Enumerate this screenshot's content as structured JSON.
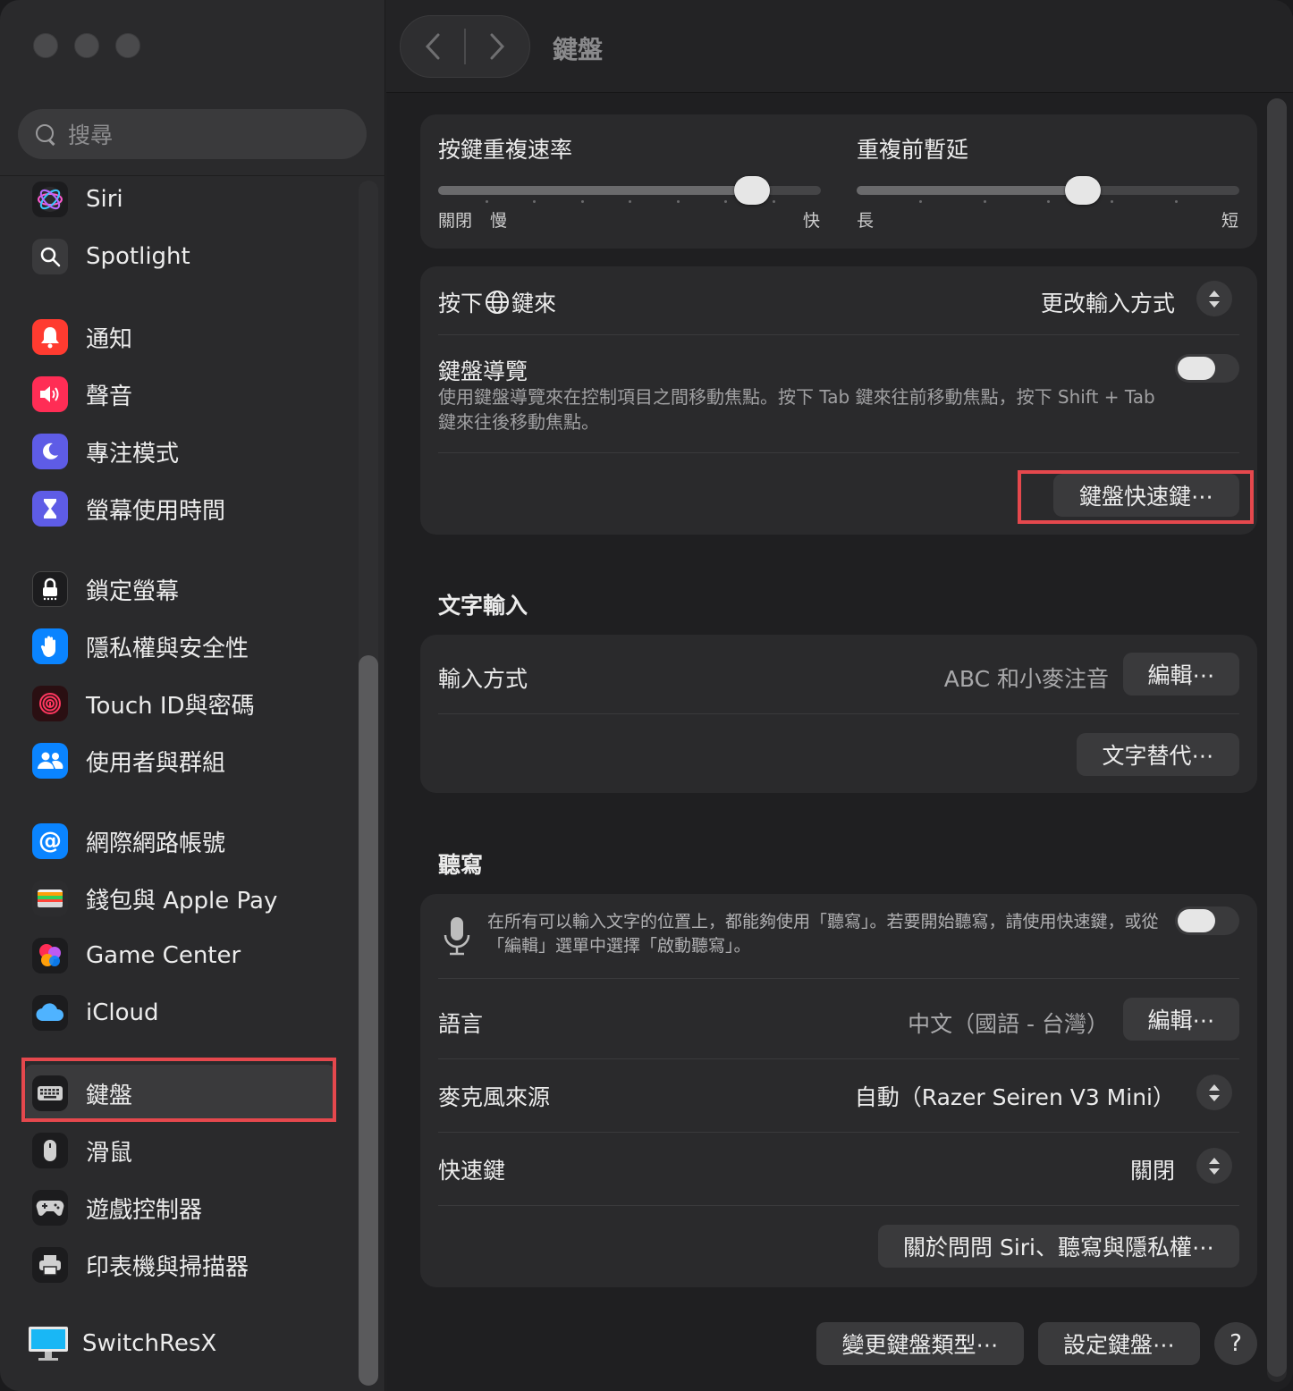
{
  "window": {
    "title": "鍵盤"
  },
  "search": {
    "placeholder": "搜尋"
  },
  "sidebar": {
    "items": [
      {
        "label": "Siri",
        "icon": "siri-icon",
        "color": "#1c1c1e"
      },
      {
        "label": "Spotlight",
        "icon": "spotlight-icon",
        "color": "#3a3a3c"
      },
      {
        "label": "通知",
        "icon": "bell-icon",
        "color": "#ff3b30"
      },
      {
        "label": "聲音",
        "icon": "speaker-icon",
        "color": "#ff2d55"
      },
      {
        "label": "專注模式",
        "icon": "moon-icon",
        "color": "#5e5ce6"
      },
      {
        "label": "螢幕使用時間",
        "icon": "hourglass-icon",
        "color": "#5e5ce6"
      },
      {
        "label": "鎖定螢幕",
        "icon": "lock-icon",
        "color": "#1c1c1e"
      },
      {
        "label": "隱私權與安全性",
        "icon": "hand-icon",
        "color": "#0a84ff"
      },
      {
        "label": "Touch ID與密碼",
        "icon": "fingerprint-icon",
        "color": "#ffffff"
      },
      {
        "label": "使用者與群組",
        "icon": "users-icon",
        "color": "#0a84ff"
      },
      {
        "label": "網際網路帳號",
        "icon": "at-icon",
        "color": "#0a84ff"
      },
      {
        "label": "錢包與 Apple Pay",
        "icon": "wallet-icon",
        "color": "#2c2c2e"
      },
      {
        "label": "Game Center",
        "icon": "game-center-icon",
        "color": "#ffffff"
      },
      {
        "label": "iCloud",
        "icon": "cloud-icon",
        "color": "#ffffff"
      },
      {
        "label": "鍵盤",
        "icon": "keyboard-icon",
        "color": "#636366"
      },
      {
        "label": "滑鼠",
        "icon": "mouse-icon",
        "color": "#636366"
      },
      {
        "label": "遊戲控制器",
        "icon": "gamepad-icon",
        "color": "#636366"
      },
      {
        "label": "印表機與掃描器",
        "icon": "printer-icon",
        "color": "#636366"
      },
      {
        "label": "SwitchResX",
        "icon": "monitor-icon",
        "color": "#0a84ff"
      }
    ],
    "selected_index": 14
  },
  "key_repeat": {
    "rate_label": "按鍵重複速率",
    "rate_left_1": "關閉",
    "rate_left_2": "慢",
    "rate_right": "快",
    "rate_value": 0.82,
    "delay_label": "重複前暫延",
    "delay_left": "長",
    "delay_right": "短",
    "delay_value": 0.59
  },
  "globe_key": {
    "label_prefix": "按下",
    "label_suffix": "鍵來",
    "value": "更改輸入方式"
  },
  "keyboard_nav": {
    "label": "鍵盤導覽",
    "description": "使用鍵盤導覽來在控制項目之間移動焦點。按下 Tab 鍵來往前移動焦點，按下 Shift + Tab 鍵來往後移動焦點。",
    "enabled": false
  },
  "shortcuts_button": "鍵盤快速鍵⋯",
  "text_input": {
    "section_title": "文字輸入",
    "input_sources_label": "輸入方式",
    "input_sources_value": "ABC 和小麥注音",
    "edit_button": "編輯⋯",
    "text_replace_button": "文字替代⋯"
  },
  "dictation": {
    "section_title": "聽寫",
    "description": "在所有可以輸入文字的位置上，都能夠使用「聽寫」。若要開始聽寫，請使用快速鍵，或從「編輯」選單中選擇「啟動聽寫」。",
    "enabled": false,
    "language_label": "語言",
    "language_value": "中文（國語 - 台灣）",
    "language_edit_button": "編輯⋯",
    "mic_label": "麥克風來源",
    "mic_value": "自動（Razer Seiren V3 Mini）",
    "shortcut_label": "快速鍵",
    "shortcut_value": "關閉",
    "about_button": "關於問問 Siri、聽寫與隱私權⋯"
  },
  "footer": {
    "change_type_button": "變更鍵盤類型⋯",
    "setup_button": "設定鍵盤⋯",
    "help_button": "?"
  },
  "accent": {
    "highlight": "#e5484d"
  }
}
